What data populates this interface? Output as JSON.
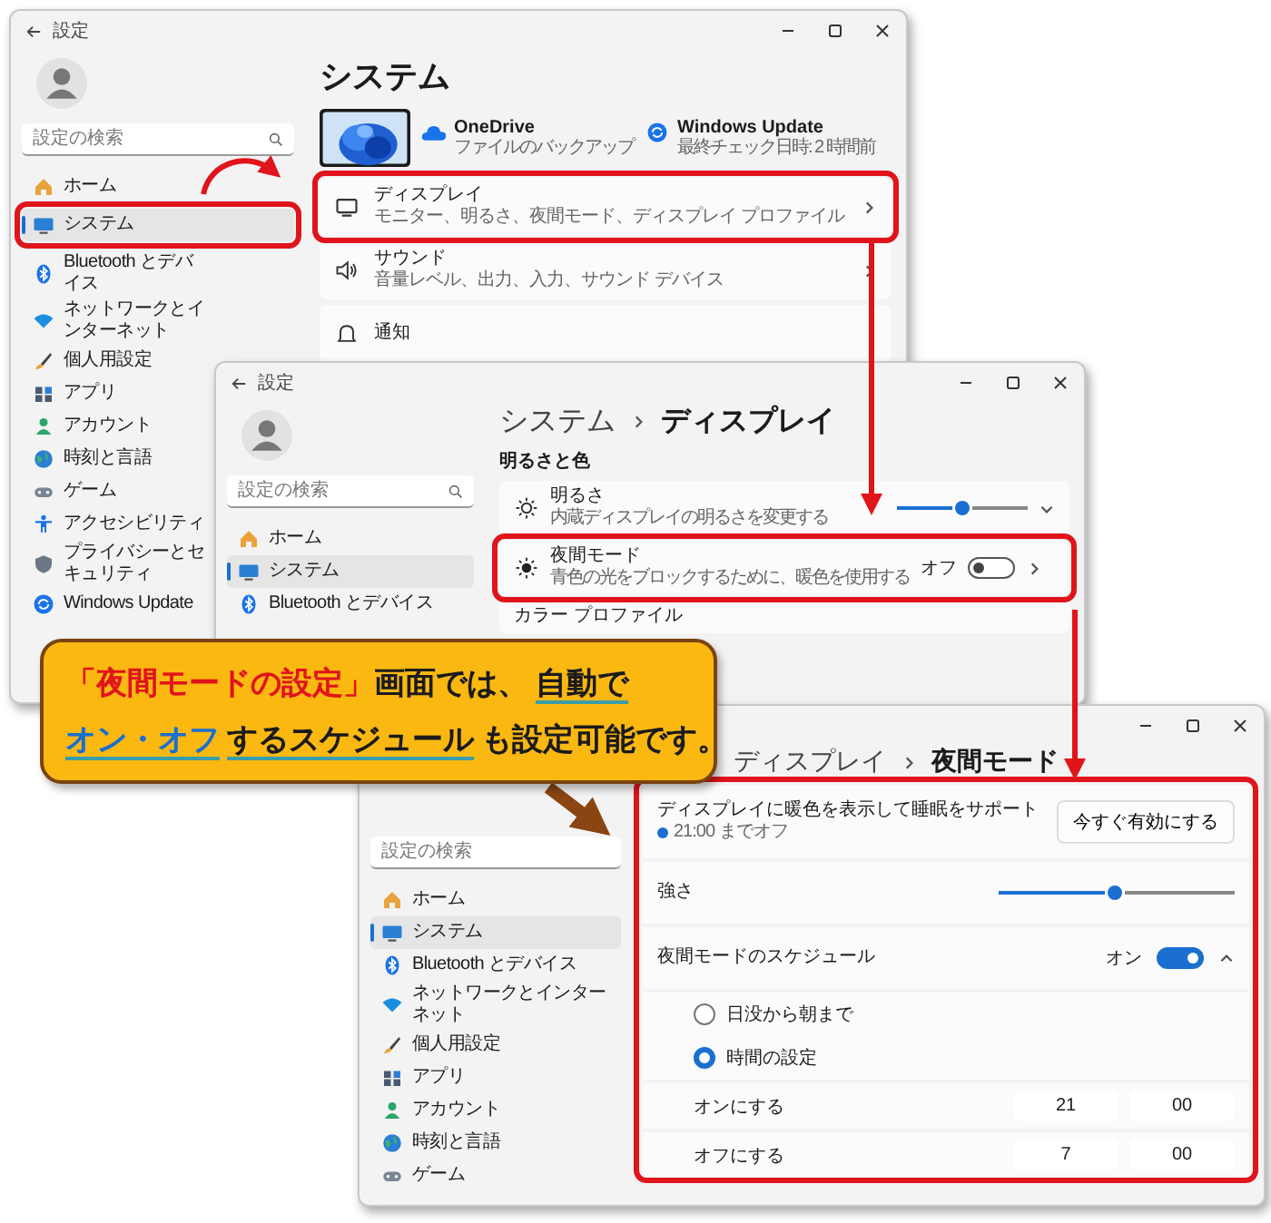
{
  "window_system": {
    "title": "設定",
    "search": {
      "placeholder": "設定の検索"
    },
    "nav": [
      {
        "label": "ホーム",
        "selected": false
      },
      {
        "label": "システム",
        "selected": true
      },
      {
        "label": "Bluetooth とデバイス",
        "selected": false
      },
      {
        "label": "ネットワークとインターネット",
        "selected": false
      },
      {
        "label": "個人用設定",
        "selected": false
      },
      {
        "label": "アプリ",
        "selected": false
      },
      {
        "label": "アカウント",
        "selected": false
      },
      {
        "label": "時刻と言語",
        "selected": false
      },
      {
        "label": "ゲーム",
        "selected": false
      },
      {
        "label": "アクセシビリティ",
        "selected": false
      },
      {
        "label": "プライバシーとセキュリティ",
        "selected": false
      },
      {
        "label": "Windows Update",
        "selected": false
      }
    ],
    "heading": "システム",
    "services": [
      {
        "title": "OneDrive",
        "subtitle": "ファイルのバックアップ"
      },
      {
        "title": "Windows Update",
        "subtitle": "最終チェック日時: 2 時間前"
      }
    ],
    "settings": [
      {
        "title": "ディスプレイ",
        "subtitle": "モニター、明るさ、夜間モード、ディスプレイ プロファイル"
      },
      {
        "title": "サウンド",
        "subtitle": "音量レベル、出力、入力、サウンド デバイス"
      },
      {
        "title": "通知"
      }
    ]
  },
  "window_display": {
    "title": "設定",
    "search": {
      "placeholder": "設定の検索"
    },
    "nav": [
      {
        "label": "ホーム",
        "selected": false
      },
      {
        "label": "システム",
        "selected": true
      },
      {
        "label": "Bluetooth とデバイス",
        "selected": false
      }
    ],
    "breadcrumb": [
      "システム",
      "ディスプレイ"
    ],
    "section": "明るさと色",
    "settings": [
      {
        "kind": "slider",
        "title": "明るさ",
        "subtitle": "内蔵ディスプレイの明るさを変更する",
        "level": 0.5
      },
      {
        "kind": "toggle",
        "title": "夜間モード",
        "subtitle": "青色の光をブロックするために、暖色を使用する",
        "status": "オフ",
        "on": false
      },
      {
        "kind": "plain",
        "title": "カラー プロファイル"
      }
    ]
  },
  "window_night_light": {
    "search": {
      "placeholder": "設定の検索"
    },
    "nav": [
      {
        "label": "ホーム",
        "selected": false
      },
      {
        "label": "システム",
        "selected": true
      },
      {
        "label": "Bluetooth とデバイス",
        "selected": false
      },
      {
        "label": "ネットワークとインターネット",
        "selected": false
      },
      {
        "label": "個人用設定",
        "selected": false
      },
      {
        "label": "アプリ",
        "selected": false
      },
      {
        "label": "アカウント",
        "selected": false
      },
      {
        "label": "時刻と言語",
        "selected": false
      },
      {
        "label": "ゲーム",
        "selected": false
      }
    ],
    "breadcrumb": [
      "ディスプレイ",
      "夜間モード"
    ],
    "info": {
      "title": "ディスプレイに暖色を表示して睡眠をサポート",
      "status": "21:00 までオフ",
      "button": "今すぐ有効にする"
    },
    "strength": {
      "label": "強さ",
      "level": 0.49
    },
    "schedule": {
      "label": "夜間モードのスケジュール",
      "status": "オン",
      "on": true,
      "expanded": true,
      "options": [
        {
          "label": "日没から朝まで",
          "selected": false
        },
        {
          "label": "時間の設定",
          "selected": true
        }
      ],
      "times": [
        {
          "label": "オンにする",
          "hour": "21",
          "minute": "00"
        },
        {
          "label": "オフにする",
          "hour": "7",
          "minute": "00"
        }
      ]
    }
  },
  "callout": {
    "lines": [
      [
        {
          "text": "「夜間モードの設定」",
          "kind": "emphasis"
        },
        {
          "text": "画面では、",
          "kind": "plain"
        },
        {
          "text": "自動で",
          "kind": "underline"
        }
      ],
      [
        {
          "text": "オン・オフ",
          "kind": "link"
        },
        {
          "text": "するスケジュール",
          "kind": "underline"
        },
        {
          "text": "も設定可能です。",
          "kind": "plain"
        }
      ]
    ]
  }
}
